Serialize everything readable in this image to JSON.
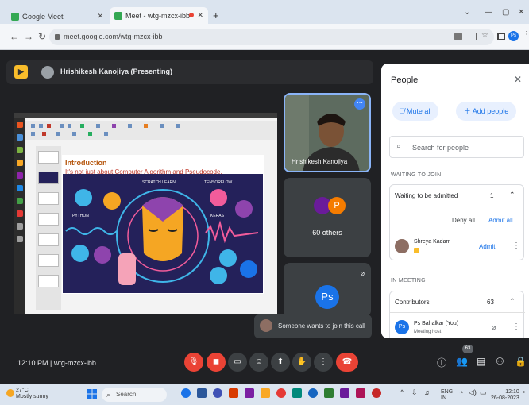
{
  "browser": {
    "tabs": [
      {
        "label": "Google Meet",
        "active": false
      },
      {
        "label": "Meet - wtg-mzcx-ibb",
        "active": true
      }
    ],
    "new_tab": "+",
    "url": "meet.google.com/wtg-mzcx-ibb",
    "profile_initials": "Ps",
    "window_controls": [
      "⌄",
      "—",
      "▢",
      "✕"
    ]
  },
  "presenting": {
    "name": "Hrishikesh Kanojiya (Presenting)"
  },
  "slide": {
    "heading": "Introduction",
    "subtitle": "It's not just about Computer Algorithm and Pseudocode.",
    "art_labels": [
      "SCRATCH LEARN",
      "TENSORFLOW",
      "PYTHON",
      "KERAS"
    ]
  },
  "tiles": {
    "speaker_name": "Hrishikesh Kanojiya",
    "others_label": "60 others",
    "others_avatar": "P",
    "ps_avatar": "Ps"
  },
  "toast": {
    "text": "Someone wants to join this call"
  },
  "panel": {
    "title": "People",
    "mute_all": "Mute all",
    "add_people": "Add people",
    "search_placeholder": "Search for people",
    "waiting_section": "WAITING TO JOIN",
    "waiting_label": "Waiting to be admitted",
    "waiting_count": "1",
    "deny_all": "Deny all",
    "admit_all": "Admit all",
    "waiting_person": "Shreya Kadam",
    "admit": "Admit",
    "in_meeting_section": "IN MEETING",
    "contributors_label": "Contributors",
    "contributors_count": "63",
    "host_name": "Ps Bahalkar (You)",
    "host_role": "Meeting host",
    "host_avatar": "Ps"
  },
  "controls": {
    "time": "12:10 PM",
    "separator": "|",
    "meeting_id": "wtg-mzcx-ibb",
    "participants_badge": "63"
  },
  "taskbar": {
    "temperature": "27°C",
    "weather": "Mostly sunny",
    "search": "Search",
    "lang_top": "ENG",
    "lang_bottom": "IN",
    "clock_time": "12:10",
    "clock_date": "26-08-2023"
  }
}
